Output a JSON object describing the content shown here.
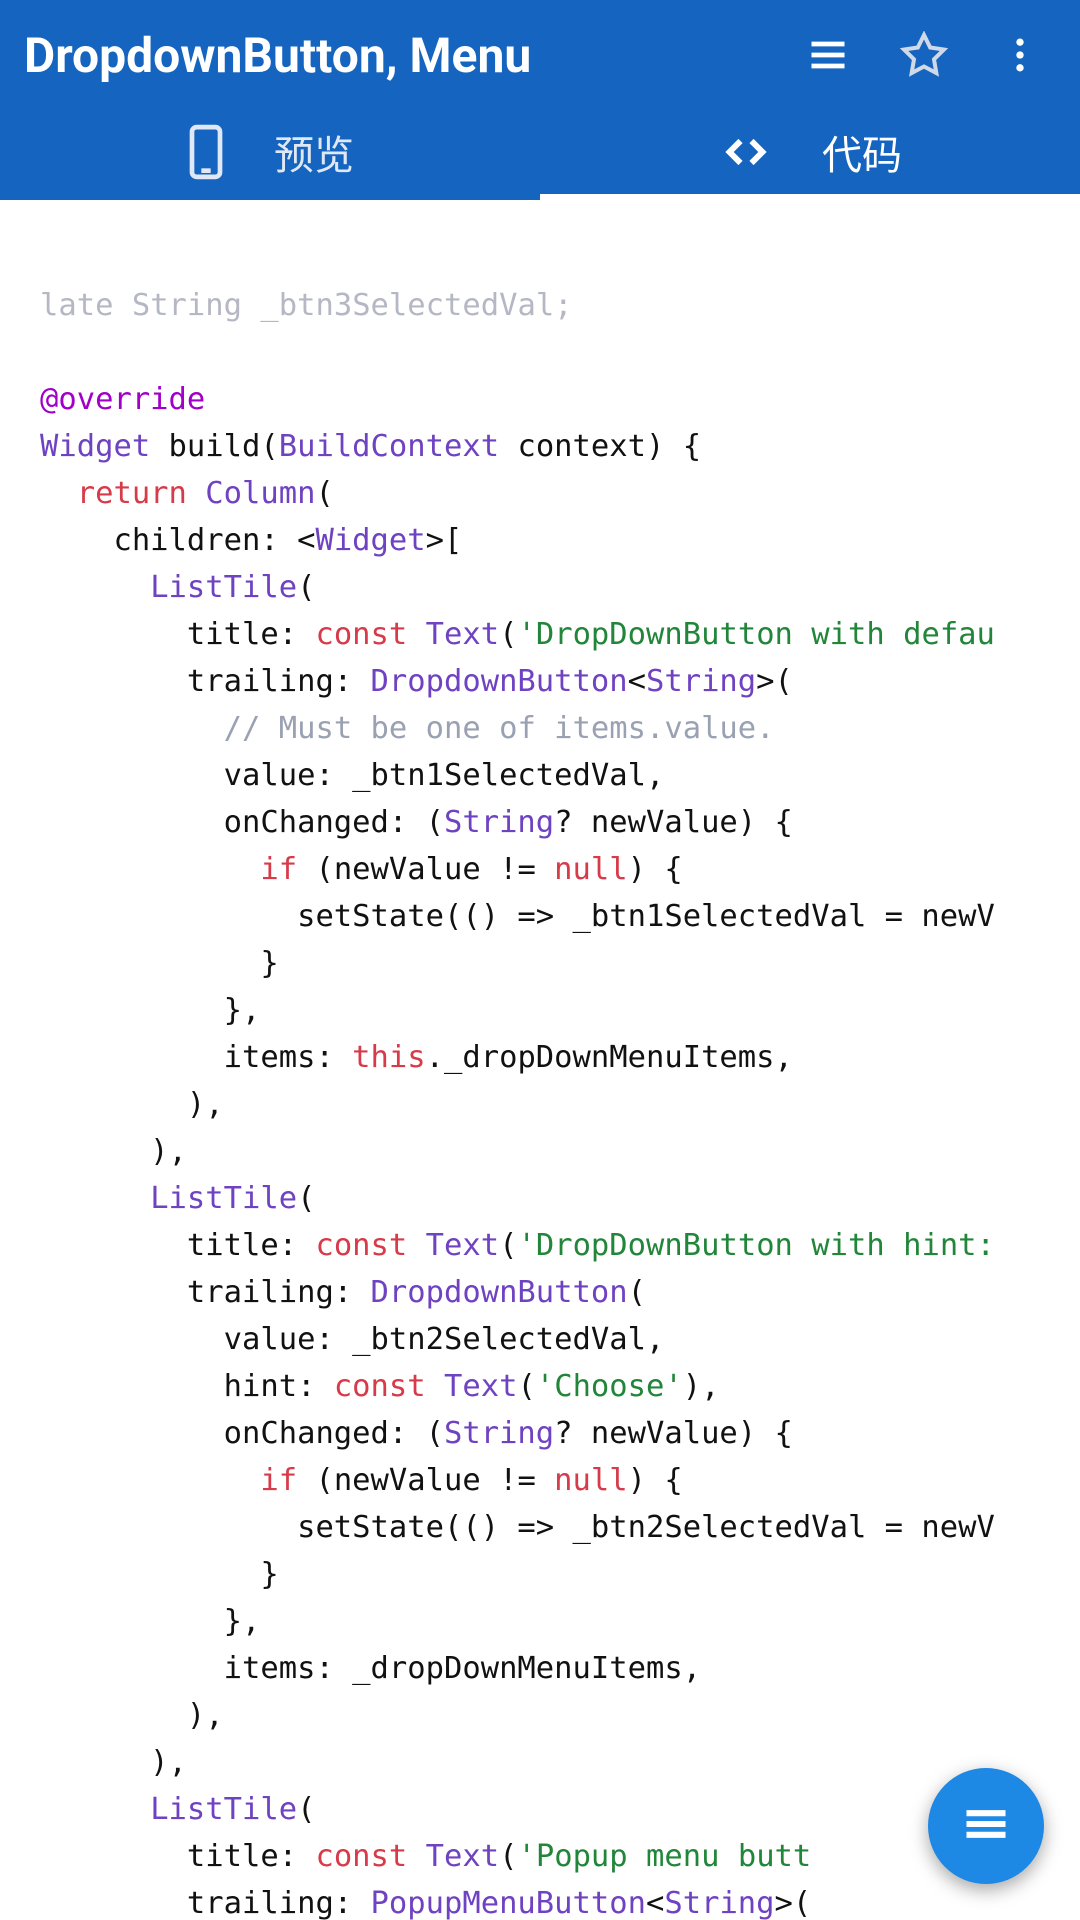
{
  "header": {
    "title": "DropdownButton, Menu",
    "icons": [
      "hamburger-icon",
      "star-outline-icon",
      "more-vert-icon"
    ]
  },
  "tabs": {
    "preview": {
      "label": "预览",
      "icon": "phone-icon",
      "active": false
    },
    "code": {
      "label": "代码",
      "icon": "code-icon",
      "active": true
    }
  },
  "syntax_colors": {
    "annotation": "#a000c8",
    "type": "#6f42c1",
    "keyword": "#d73a49",
    "string": "#22863a",
    "comment": "#99a1b3",
    "cutoff": "#b5b8c4",
    "text": "#111111"
  },
  "code_tokens": [
    [
      [
        "cut",
        "late "
      ],
      [
        "cut",
        "String"
      ],
      [
        "cut",
        " _btn3SelectedVal;"
      ]
    ],
    [],
    [
      [
        "anno",
        "@override"
      ]
    ],
    [
      [
        "type",
        "Widget"
      ],
      [
        "txt",
        " build("
      ],
      [
        "type",
        "BuildContext"
      ],
      [
        "txt",
        " context) {"
      ]
    ],
    [
      [
        "txt",
        "  "
      ],
      [
        "kw",
        "return"
      ],
      [
        "txt",
        " "
      ],
      [
        "type",
        "Column"
      ],
      [
        "txt",
        "("
      ]
    ],
    [
      [
        "txt",
        "    children: <"
      ],
      [
        "type",
        "Widget"
      ],
      [
        "txt",
        ">["
      ]
    ],
    [
      [
        "txt",
        "      "
      ],
      [
        "type",
        "ListTile"
      ],
      [
        "txt",
        "("
      ]
    ],
    [
      [
        "txt",
        "        title: "
      ],
      [
        "kw",
        "const"
      ],
      [
        "txt",
        " "
      ],
      [
        "type",
        "Text"
      ],
      [
        "txt",
        "("
      ],
      [
        "str",
        "'DropDownButton with defau"
      ]
    ],
    [
      [
        "txt",
        "        trailing: "
      ],
      [
        "type",
        "DropdownButton"
      ],
      [
        "txt",
        "<"
      ],
      [
        "type",
        "String"
      ],
      [
        "txt",
        ">("
      ]
    ],
    [
      [
        "txt",
        "          "
      ],
      [
        "cm",
        "// Must be one of items.value."
      ]
    ],
    [
      [
        "txt",
        "          value: _btn1SelectedVal,"
      ]
    ],
    [
      [
        "txt",
        "          onChanged: ("
      ],
      [
        "type",
        "String"
      ],
      [
        "txt",
        "? newValue) {"
      ]
    ],
    [
      [
        "txt",
        "            "
      ],
      [
        "kw",
        "if"
      ],
      [
        "txt",
        " (newValue != "
      ],
      [
        "kw",
        "null"
      ],
      [
        "txt",
        ") {"
      ]
    ],
    [
      [
        "txt",
        "              setState(() => _btn1SelectedVal = newV"
      ]
    ],
    [
      [
        "txt",
        "            }"
      ]
    ],
    [
      [
        "txt",
        "          },"
      ]
    ],
    [
      [
        "txt",
        "          items: "
      ],
      [
        "kw",
        "this"
      ],
      [
        "txt",
        "._dropDownMenuItems,"
      ]
    ],
    [
      [
        "txt",
        "        ),"
      ]
    ],
    [
      [
        "txt",
        "      ),"
      ]
    ],
    [
      [
        "txt",
        "      "
      ],
      [
        "type",
        "ListTile"
      ],
      [
        "txt",
        "("
      ]
    ],
    [
      [
        "txt",
        "        title: "
      ],
      [
        "kw",
        "const"
      ],
      [
        "txt",
        " "
      ],
      [
        "type",
        "Text"
      ],
      [
        "txt",
        "("
      ],
      [
        "str",
        "'DropDownButton with hint:"
      ]
    ],
    [
      [
        "txt",
        "        trailing: "
      ],
      [
        "type",
        "DropdownButton"
      ],
      [
        "txt",
        "("
      ]
    ],
    [
      [
        "txt",
        "          value: _btn2SelectedVal,"
      ]
    ],
    [
      [
        "txt",
        "          hint: "
      ],
      [
        "kw",
        "const"
      ],
      [
        "txt",
        " "
      ],
      [
        "type",
        "Text"
      ],
      [
        "txt",
        "("
      ],
      [
        "str",
        "'Choose'"
      ],
      [
        "txt",
        "),"
      ]
    ],
    [
      [
        "txt",
        "          onChanged: ("
      ],
      [
        "type",
        "String"
      ],
      [
        "txt",
        "? newValue) {"
      ]
    ],
    [
      [
        "txt",
        "            "
      ],
      [
        "kw",
        "if"
      ],
      [
        "txt",
        " (newValue != "
      ],
      [
        "kw",
        "null"
      ],
      [
        "txt",
        ") {"
      ]
    ],
    [
      [
        "txt",
        "              setState(() => _btn2SelectedVal = newV"
      ]
    ],
    [
      [
        "txt",
        "            }"
      ]
    ],
    [
      [
        "txt",
        "          },"
      ]
    ],
    [
      [
        "txt",
        "          items: _dropDownMenuItems,"
      ]
    ],
    [
      [
        "txt",
        "        ),"
      ]
    ],
    [
      [
        "txt",
        "      ),"
      ]
    ],
    [
      [
        "txt",
        "      "
      ],
      [
        "type",
        "ListTile"
      ],
      [
        "txt",
        "("
      ]
    ],
    [
      [
        "txt",
        "        title: "
      ],
      [
        "kw",
        "const"
      ],
      [
        "txt",
        " "
      ],
      [
        "type",
        "Text"
      ],
      [
        "txt",
        "("
      ],
      [
        "str",
        "'Popup menu butt"
      ]
    ],
    [
      [
        "txt",
        "        trailing: "
      ],
      [
        "type",
        "PopupMenuButton"
      ],
      [
        "txt",
        "<"
      ],
      [
        "type",
        "String"
      ],
      [
        "txt",
        ">("
      ]
    ]
  ],
  "fab": {
    "icon": "menu-icon"
  }
}
